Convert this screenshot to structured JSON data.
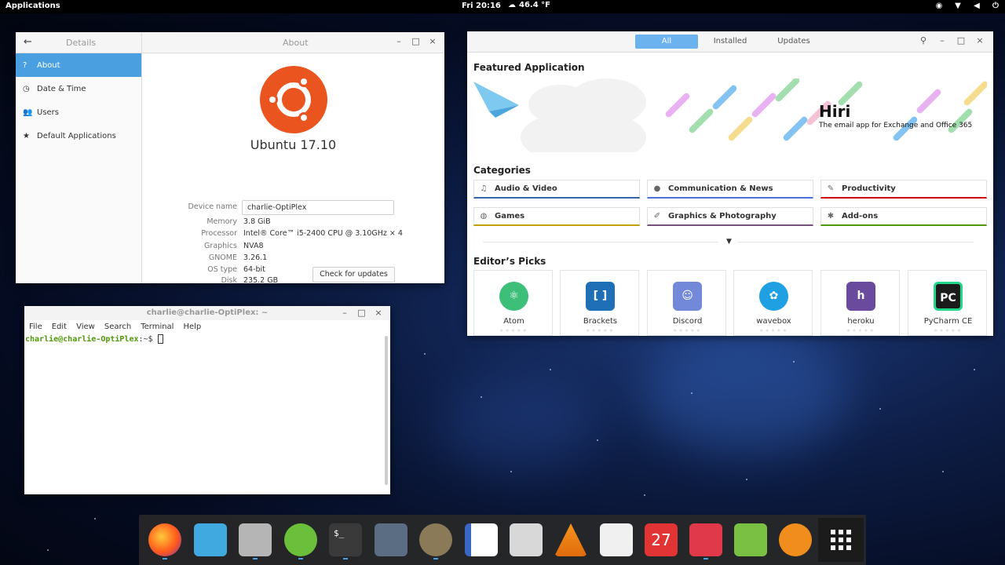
{
  "topbar": {
    "applications": "Applications",
    "clock": "Fri 20:16",
    "weather": "46.4 °F"
  },
  "settings_window": {
    "left_title": "Details",
    "right_title": "About",
    "sidebar": [
      {
        "label": "About",
        "icon": "question-icon",
        "active": true
      },
      {
        "label": "Date & Time",
        "icon": "clock-icon",
        "active": false
      },
      {
        "label": "Users",
        "icon": "users-icon",
        "active": false
      },
      {
        "label": "Default Applications",
        "icon": "star-icon",
        "active": false
      }
    ],
    "os_name": "Ubuntu 17.10",
    "device_name_label": "Device name",
    "device_name_value": "charlie-OptiPlex",
    "info": [
      {
        "key": "Memory",
        "value": "3.8 GiB"
      },
      {
        "key": "Processor",
        "value": "Intel® Core™ i5-2400 CPU @ 3.10GHz × 4"
      },
      {
        "key": "Graphics",
        "value": "NVA8"
      },
      {
        "key": "GNOME",
        "value": "3.26.1"
      },
      {
        "key": "OS type",
        "value": "64-bit"
      },
      {
        "key": "Disk",
        "value": "235.2 GB"
      }
    ],
    "check_updates": "Check for updates"
  },
  "terminal": {
    "title": "charlie@charlie-OptiPlex: ~",
    "menu": [
      "File",
      "Edit",
      "View",
      "Search",
      "Terminal",
      "Help"
    ],
    "prompt_user": "charlie@charlie-OptiPlex",
    "prompt_suffix": ":~$ "
  },
  "software": {
    "tabs": [
      "All",
      "Installed",
      "Updates"
    ],
    "featured_title": "Featured Application",
    "featured_name": "Hiri",
    "featured_tagline": "The email app for Exchange and Office 365",
    "categories_title": "Categories",
    "categories": [
      {
        "label": "Audio & Video",
        "icon": "music-icon",
        "color": "#3465a4"
      },
      {
        "label": "Communication & News",
        "icon": "person-icon",
        "color": "#4a6fd8"
      },
      {
        "label": "Productivity",
        "icon": "pencil-icon",
        "color": "#cc0000"
      },
      {
        "label": "Games",
        "icon": "gamepad-icon",
        "color": "#c4a000"
      },
      {
        "label": "Graphics & Photography",
        "icon": "brush-icon",
        "color": "#75507b"
      },
      {
        "label": "Add-ons",
        "icon": "puzzle-icon",
        "color": "#4e9a06"
      }
    ],
    "editors_title": "Editor’s Picks",
    "picks": [
      {
        "name": "Atom",
        "color": "#3dbf7a",
        "glyph": "⚛"
      },
      {
        "name": "Brackets",
        "color": "#1e6fb5",
        "glyph": "[ ]"
      },
      {
        "name": "Discord",
        "color": "#7289da",
        "glyph": "☺"
      },
      {
        "name": "wavebox",
        "color": "#1fa0e3",
        "glyph": "✿"
      },
      {
        "name": "heroku",
        "color": "#6a4a9c",
        "glyph": "h"
      },
      {
        "name": "PyCharm CE",
        "color": "#1b1b1b",
        "glyph": "PC"
      }
    ]
  },
  "dock": {
    "items": [
      {
        "name": "firefox-icon",
        "color": "#ff7b1c"
      },
      {
        "name": "files-icon",
        "color": "#3fa9e0"
      },
      {
        "name": "software-center-icon",
        "color": "#b5b5b5"
      },
      {
        "name": "settings-icon",
        "color": "#6bbf3b"
      },
      {
        "name": "terminal-icon",
        "color": "#3a3a3a"
      },
      {
        "name": "video-icon",
        "color": "#5a6d82"
      },
      {
        "name": "gimp-icon",
        "color": "#8a7a58"
      },
      {
        "name": "writer-icon",
        "color": "#3a66c4"
      },
      {
        "name": "text-editor-icon",
        "color": "#d8d8d8"
      },
      {
        "name": "vlc-icon",
        "color": "#f28a1c"
      },
      {
        "name": "calculator-icon",
        "color": "#f0f0f0"
      },
      {
        "name": "calendar-icon",
        "color": "#e23434"
      },
      {
        "name": "mixer-icon",
        "color": "#e0394a"
      },
      {
        "name": "music-player-icon",
        "color": "#7ac143"
      },
      {
        "name": "sync-icon",
        "color": "#f08d1c"
      }
    ],
    "calendar_day": "27"
  }
}
